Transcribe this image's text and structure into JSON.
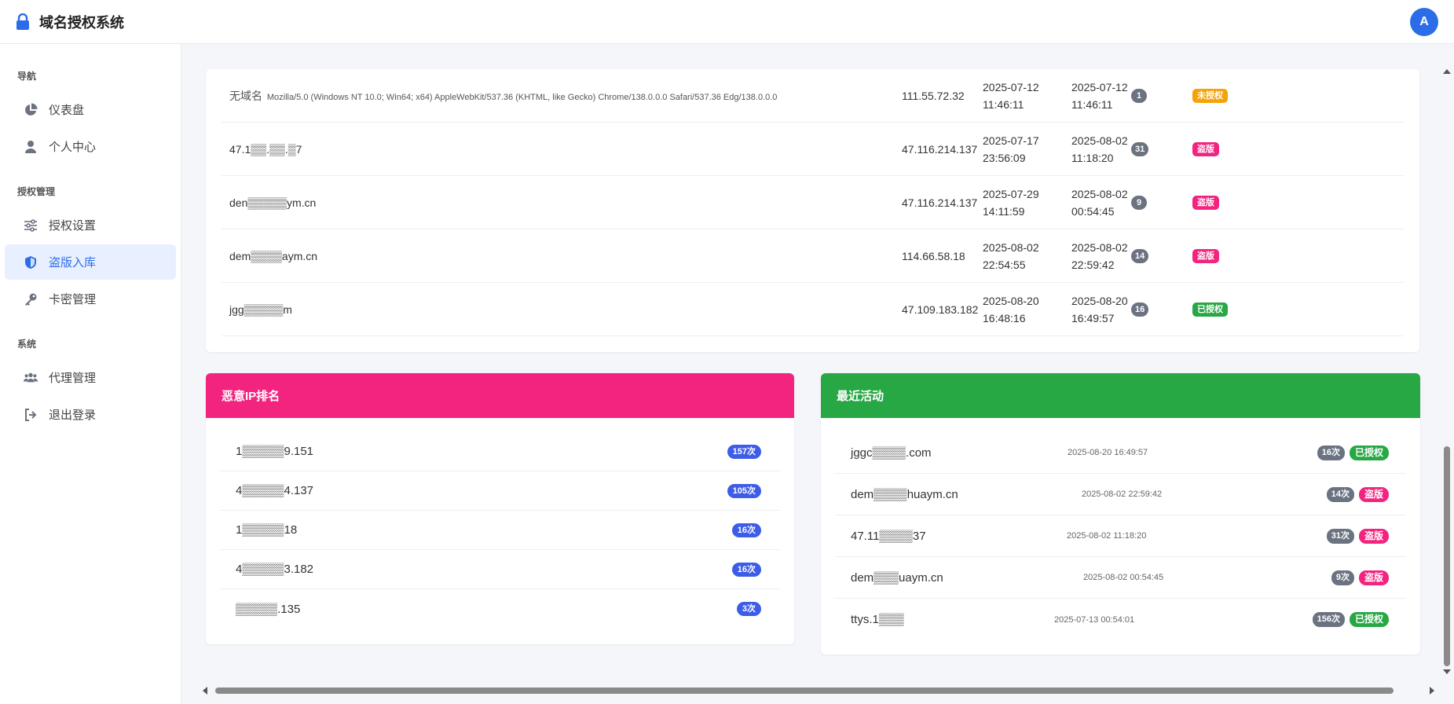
{
  "app": {
    "title": "域名授权系统",
    "avatar_letter": "A"
  },
  "colors": {
    "accent": "#2b6de8",
    "pink": "#f22480",
    "green": "#28a745",
    "orange": "#f5a30a",
    "gray": "#6b7280"
  },
  "sidebar": {
    "sections": [
      {
        "title": "导航",
        "items": [
          {
            "label": "仪表盘",
            "icon": "pie-chart-icon"
          },
          {
            "label": "个人中心",
            "icon": "user-icon"
          }
        ]
      },
      {
        "title": "授权管理",
        "items": [
          {
            "label": "授权设置",
            "icon": "sliders-icon"
          },
          {
            "label": "盗版入库",
            "icon": "shield-icon",
            "active": true
          },
          {
            "label": "卡密管理",
            "icon": "key-icon"
          }
        ]
      },
      {
        "title": "系统",
        "items": [
          {
            "label": "代理管理",
            "icon": "users-icon"
          },
          {
            "label": "退出登录",
            "icon": "logout-icon"
          }
        ]
      }
    ]
  },
  "records": [
    {
      "domain": "无域名",
      "ua": "Mozilla/5.0 (Windows NT 10.0; Win64; x64) AppleWebKit/537.36 (KHTML, like Gecko) Chrome/138.0.0.0 Safari/537.36 Edg/138.0.0.0",
      "ip": "111.55.72.32",
      "first_date": "2025-07-12",
      "first_time": "11:46:11",
      "last_date": "2025-07-12",
      "last_time": "11:46:11",
      "count": "1",
      "status": "未授权",
      "status_color": "#f5a30a"
    },
    {
      "domain": "47.1▒▒.▒▒.▒7",
      "ua": "",
      "ip": "47.116.214.137",
      "first_date": "2025-07-17",
      "first_time": "23:56:09",
      "last_date": "2025-08-02",
      "last_time": "11:18:20",
      "count": "31",
      "status": "盗版",
      "status_color": "#f22480"
    },
    {
      "domain": "den▒▒▒▒▒ym.cn",
      "ua": "",
      "ip": "47.116.214.137",
      "first_date": "2025-07-29",
      "first_time": "14:11:59",
      "last_date": "2025-08-02",
      "last_time": "00:54:45",
      "count": "9",
      "status": "盗版",
      "status_color": "#f22480"
    },
    {
      "domain": "dem▒▒▒▒aym.cn",
      "ua": "",
      "ip": "114.66.58.18",
      "first_date": "2025-08-02",
      "first_time": "22:54:55",
      "last_date": "2025-08-02",
      "last_time": "22:59:42",
      "count": "14",
      "status": "盗版",
      "status_color": "#f22480"
    },
    {
      "domain": "jgg▒▒▒▒▒m",
      "ua": "",
      "ip": "47.109.183.182",
      "first_date": "2025-08-20",
      "first_time": "16:48:16",
      "last_date": "2025-08-20",
      "last_time": "16:49:57",
      "count": "16",
      "status": "已授权",
      "status_color": "#28a745"
    }
  ],
  "malicious_ip": {
    "title": "恶意IP排名",
    "rows": [
      {
        "ip": "1▒▒▒▒▒9.151",
        "count": "157次"
      },
      {
        "ip": "4▒▒▒▒▒4.137",
        "count": "105次"
      },
      {
        "ip": "1▒▒▒▒▒18",
        "count": "16次"
      },
      {
        "ip": "4▒▒▒▒▒3.182",
        "count": "16次"
      },
      {
        "ip": "▒▒▒▒▒.135",
        "count": "3次"
      }
    ]
  },
  "recent_activity": {
    "title": "最近活动",
    "rows": [
      {
        "domain": "jggc▒▒▒▒.com",
        "time": "2025-08-20 16:49:57",
        "count": "16次",
        "status": "已授权",
        "status_color": "#28a745"
      },
      {
        "domain": "dem▒▒▒▒huaym.cn",
        "time": "2025-08-02 22:59:42",
        "count": "14次",
        "status": "盗版",
        "status_color": "#f22480"
      },
      {
        "domain": "47.11▒▒▒▒37",
        "time": "2025-08-02 11:18:20",
        "count": "31次",
        "status": "盗版",
        "status_color": "#f22480"
      },
      {
        "domain": "dem▒▒▒uaym.cn",
        "time": "2025-08-02 00:54:45",
        "count": "9次",
        "status": "盗版",
        "status_color": "#f22480"
      },
      {
        "domain": "ttys.1▒▒▒",
        "time": "2025-07-13 00:54:01",
        "count": "156次",
        "status": "已授权",
        "status_color": "#28a745"
      }
    ]
  }
}
